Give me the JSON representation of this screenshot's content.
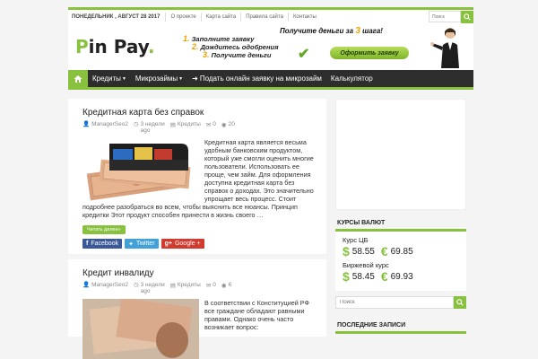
{
  "topbar": {
    "date": "Понедельник , Август 28 2017",
    "links": [
      "О проекте",
      "Карта сайта",
      "Правила сайта",
      "Контакты"
    ],
    "search_placeholder": "Поиск"
  },
  "logo": {
    "first": "P",
    "rest": "in Pay",
    "dot": "."
  },
  "banner": {
    "headline_pre": "Получите деньги за",
    "headline_num": "3",
    "headline_post": "шага!",
    "steps": [
      {
        "n": "1.",
        "text": "Заполните заявку"
      },
      {
        "n": "2.",
        "text": "Дождитесь одобрения"
      },
      {
        "n": "3.",
        "text": "Получите деньги"
      }
    ],
    "cta": "Оформить заявку"
  },
  "nav": {
    "items": [
      "Кредиты",
      "Микрозаймы",
      "Подать онлайн заявку на микрозайм",
      "Калькулятор"
    ]
  },
  "posts": [
    {
      "title": "Кредитная карта без справок",
      "author": "ManagerSeo2",
      "time_line1": "3 недели",
      "time_line2": "ago",
      "category": "Кредиты",
      "comments": "0",
      "views": "20",
      "excerpt": "Кредитная карта является весьма удобным банковским продуктом, который уже смогли оценить многие пользователи. Использовать ее проще, чем займ. Для оформления доступна кредитная карта без справок о доходах. Это значительно упрощает весь процесс. Стоит подробнее разобраться во всем, чтобы выяснить все нюансы. Принцип кредитки Этот продукт способен принести в жизнь своего …",
      "read_more": "Читать далее»"
    },
    {
      "title": "Кредит инвалиду",
      "author": "ManagerSeo2",
      "time_line1": "3 недели",
      "time_line2": "ago",
      "category": "Кредиты",
      "comments": "0",
      "views": "6",
      "excerpt": "В соответствии с Конституцией РФ все граждане обладают равными правами. Однако очень часто возникает вопрос:"
    }
  ],
  "share": {
    "facebook": "Facebook",
    "twitter": "Twitter",
    "google": "Google +"
  },
  "sidebar": {
    "rates_title": "Курсы валют",
    "cb_label": "Курс ЦБ",
    "cb_usd": "58.55",
    "cb_eur": "69.85",
    "exchange_label": "Биржевой курс",
    "ex_usd": "58.45",
    "ex_eur": "69.93",
    "search_placeholder": "Поиск",
    "latest_title": "Последние записи"
  },
  "colors": {
    "accent": "#88c13e",
    "nav_bg": "#2d2d2d",
    "cta_orange": "#f0a000"
  }
}
